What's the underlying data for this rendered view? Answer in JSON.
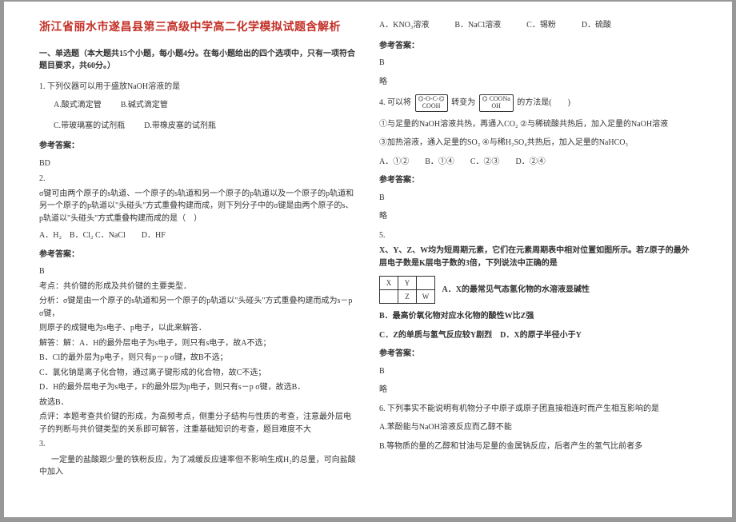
{
  "doc": {
    "title": "浙江省丽水市遂昌县第三高级中学高二化学模拟试题含解析",
    "section1_head": "一、单选题（本大题共15个小题，每小题4分。在每小题给出的四个选项中，只有一项符合题目要求，共60分。）",
    "q1": {
      "stem": "1. 下列仪器可以用于盛放NaOH溶液的是",
      "optA": "A.酸式滴定管",
      "optB": "B.碱式滴定管",
      "optC": "C.带玻璃塞的试剂瓶",
      "optD": "D.带橡皮塞的试剂瓶"
    },
    "ans_label": "参考答案：",
    "q1_ans": "BD",
    "q2": {
      "num": "2.",
      "para1": "σ键可由两个原子的s轨道、一个原子的s轨道和另一个原子的p轨道以及一个原子的p轨道和另一个原子的p轨道以\"头碰头\"方式重叠构建而成，则下列分子中的σ键是由两个原子的s、p轨道以\"头碰头\"方式重叠构建而成的是（　）",
      "opts": "A．H₂　B．Cl₂ C．NaCl　　D．HF"
    },
    "q2_ans": "B",
    "q2_kd": "考点：共价键的形成及共价键的主要类型．",
    "q2_an1": "分析：σ键是由一个原子的s轨道和另一个原子的p轨道以\"头碰头\"方式重叠构建而成为s－p σ键，",
    "q2_an2": "则原子的成键电为s电子、p电子，以此来解答．",
    "q2_sol_a": "解答：解：A．H的最外层电子为s电子，则只有s电子，故A不选；",
    "q2_sol_b": "B．Cl的最外层为p电子，则只有p－p σ键，故B不选；",
    "q2_sol_c": "C．氯化钠是离子化合物，通过离子键形成的化合物，故C不选；",
    "q2_sol_d": "D．H的最外层电子为s电子，F的最外层为p电子，则只有s－p σ键，故选B．",
    "q2_sol_e": "故选B．",
    "q2_rev1": "点评：本题考查共价键的形成，为高频考点，侧重分子结构与性质的考查，注意最外层电子的判断与共价键类型的关系即可解答，注重基础知识的考查，题目难度不大",
    "q3_num": "3.",
    "q3_text": "一定量的盐酸跟少量的铁粉反应，为了减缓反应速率但不影响生成H₂的总量，可向盐酸中加入",
    "q3_opts": {
      "a": "A．KNO₃溶液",
      "b": "B．NaCl溶液",
      "c": "C．锡粉",
      "d": "D．硫酸"
    },
    "q3_ans": "B",
    "q3_note": "略",
    "q4_pre": "4. 可以将",
    "q4_mid": "转变为",
    "q4_post": "的方法是(　　)",
    "q4_o1": "①与足量的NaOH溶液共热，再通入CO₂  ②与稀硫酸共热后，加入足量的NaOH溶液",
    "q4_o2": "③加热溶液，通入足量的SO₂  ④与稀H₂SO₄共热后，加入足量的NaHCO₃",
    "q4_choices": "A．①②　　B．①④　　C．②③　　D．②④",
    "q4_ans": "B",
    "q4_note": "略",
    "q5_num": "5.",
    "q5_text": "X、Y、Z、W均为短周期元素，它们在元素周期表中相对位置如图所示。若Z原子的最外层电子数是K层电子数的3倍，下列说法中正确的是",
    "q5_a": "A．X的最常见气态氢化物的水溶液显碱性",
    "q5_b": "B．最高价氧化物对应水化物的酸性W比Z强",
    "q5_c": "C．Z的单质与氢气反应较Y剧烈",
    "q5_d": "D．X的原子半径小于Y",
    "q5_ans": "B",
    "q5_note": "略",
    "q6_text": "6. 下列事实不能说明有机物分子中原子或原子团直接相连时而产生相互影响的是",
    "q6_a": "A.苯酚能与NaOH溶液反应而乙醇不能",
    "q6_b": "B.等物质的量的乙醇和甘油与足量的金属钠反应，后者产生的氢气比前者多"
  }
}
